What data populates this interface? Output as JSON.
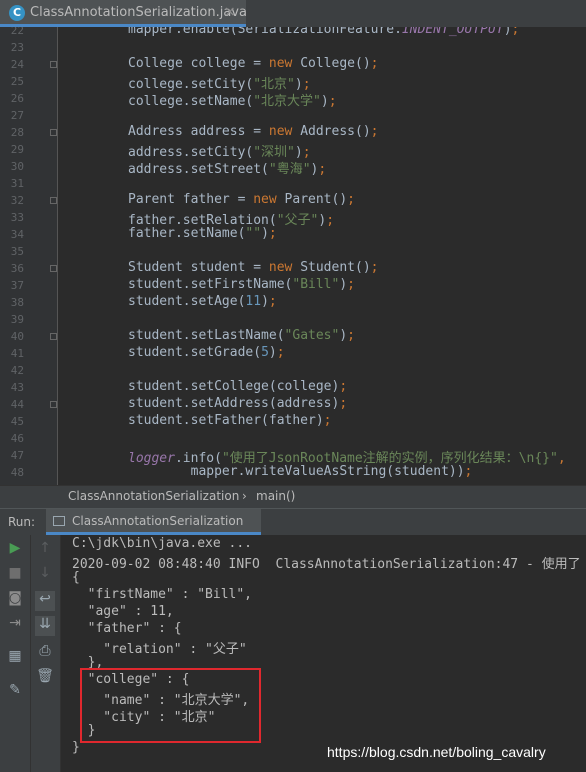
{
  "editor_tab": {
    "filename": "ClassAnnotationSerialization.java",
    "close": "×"
  },
  "code_lines": [
    {
      "n": "22",
      "html": "mapper.enable(SerializationFeature.<span class=\"fld\">INDENT_OUTPUT</span>)<span class=\"sc\">;</span>"
    },
    {
      "n": "23",
      "html": ""
    },
    {
      "n": "24",
      "html": "College college = <span class=\"kw\">new</span> College()<span class=\"sc\">;</span>"
    },
    {
      "n": "25",
      "html": "college.setCity(<span class=\"str\">\"北京\"</span>)<span class=\"sc\">;</span>"
    },
    {
      "n": "26",
      "html": "college.setName(<span class=\"str\">\"北京大学\"</span>)<span class=\"sc\">;</span>"
    },
    {
      "n": "27",
      "html": ""
    },
    {
      "n": "28",
      "html": "Address address = <span class=\"kw\">new</span> Address()<span class=\"sc\">;</span>"
    },
    {
      "n": "29",
      "html": "address.setCity(<span class=\"str\">\"深圳\"</span>)<span class=\"sc\">;</span>"
    },
    {
      "n": "30",
      "html": "address.setStreet(<span class=\"str\">\"粤海\"</span>)<span class=\"sc\">;</span>"
    },
    {
      "n": "31",
      "html": ""
    },
    {
      "n": "32",
      "html": "Parent father = <span class=\"kw\">new</span> Parent()<span class=\"sc\">;</span>"
    },
    {
      "n": "33",
      "html": "father.setRelation(<span class=\"str\">\"父子\"</span>)<span class=\"sc\">;</span>"
    },
    {
      "n": "34",
      "html": "father.setName(<span class=\"str\">\"\"</span>)<span class=\"sc\">;</span>"
    },
    {
      "n": "35",
      "html": ""
    },
    {
      "n": "36",
      "html": "Student student = <span class=\"kw\">new</span> Student()<span class=\"sc\">;</span>"
    },
    {
      "n": "37",
      "html": "student.setFirstName(<span class=\"str\">\"Bill\"</span>)<span class=\"sc\">;</span>"
    },
    {
      "n": "38",
      "html": "student.setAge(<span class=\"num\">11</span>)<span class=\"sc\">;</span>"
    },
    {
      "n": "39",
      "html": ""
    },
    {
      "n": "40",
      "html": "student.setLastName(<span class=\"str\">\"Gates\"</span>)<span class=\"sc\">;</span>"
    },
    {
      "n": "41",
      "html": "student.setGrade(<span class=\"num\">5</span>)<span class=\"sc\">;</span>"
    },
    {
      "n": "42",
      "html": ""
    },
    {
      "n": "43",
      "html": "student.setCollege(college)<span class=\"sc\">;</span>"
    },
    {
      "n": "44",
      "html": "student.setAddress(address)<span class=\"sc\">;</span>"
    },
    {
      "n": "45",
      "html": "student.setFather(father)<span class=\"sc\">;</span>"
    },
    {
      "n": "46",
      "html": ""
    },
    {
      "n": "47",
      "html": "<span class=\"fld\">logger</span>.info(<span class=\"str\">\"使用了JsonRootName注解的实例，序列化结果：\\n{}\"</span><span class=\"sc\">,</span>"
    },
    {
      "n": "48",
      "html": "        mapper.writeValueAsString(student))<span class=\"sc\">;</span>"
    }
  ],
  "breadcrumb": {
    "cls": "ClassAnnotationSerialization",
    "sep": "›",
    "method": "main()"
  },
  "run_panel": {
    "label": "Run:",
    "tab": "ClassAnnotationSerialization"
  },
  "console_lines": [
    "C:\\jdk\\bin\\java.exe ...",
    "2020-09-02 08:48:40 INFO  ClassAnnotationSerialization:47 - 使用了",
    "{",
    "  \"firstName\" : \"Bill\",",
    "  \"age\" : 11,",
    "  \"father\" : {",
    "    \"relation\" : \"父子\"",
    "  },",
    "  \"college\" : {",
    "    \"name\" : \"北京大学\",",
    "    \"city\" : \"北京\"",
    "  }",
    "}"
  ],
  "watermark": "https://blog.csdn.net/boling_cavalry",
  "icons": {
    "run": "run-icon",
    "stop": "stop-icon",
    "camera": "camera-icon",
    "login": "login-icon",
    "layout": "layout-icon",
    "pin": "pin-icon",
    "up": "up-arrow-icon",
    "down": "down-arrow-icon",
    "wrap": "soft-wrap-icon",
    "scroll": "scroll-to-end-icon",
    "print": "print-icon",
    "trash": "trash-icon"
  }
}
